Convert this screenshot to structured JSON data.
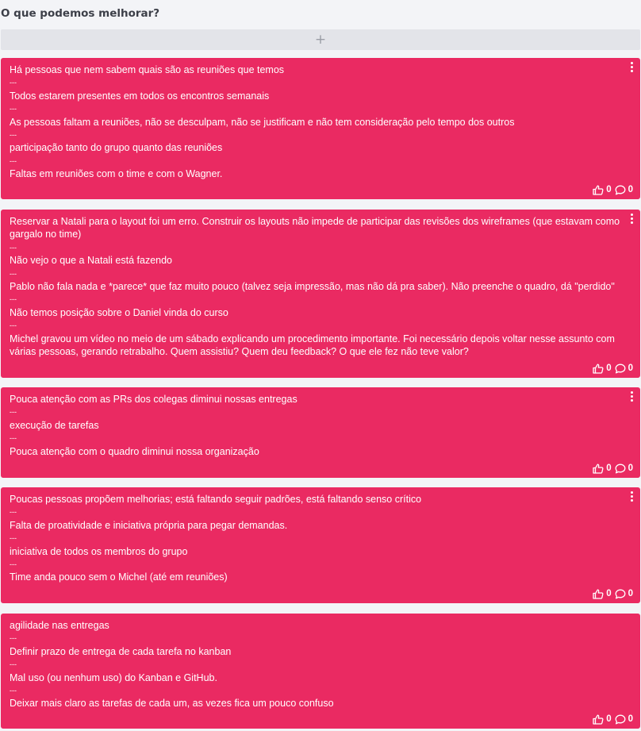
{
  "column": {
    "title": "O que podemos melhorar?",
    "add_symbol": "+"
  },
  "cards": [
    {
      "lines": [
        "Há pessoas que nem sabem quais são as reuniões que temos",
        "---",
        "Todos estarem presentes em todos os encontros semanais",
        "---",
        "As pessoas faltam a reuniões, não se desculpam, não se justificam e não tem consideração pelo tempo dos outros",
        "---",
        "participação tanto do grupo quanto das reuniões",
        "---",
        "Faltas em reuniões com o time e com o Wagner."
      ],
      "likes": "0",
      "comments": "0",
      "has_menu": true
    },
    {
      "lines": [
        "Reservar a Natali para o layout foi um erro. Construir os layouts não impede de participar das revisões dos wireframes (que estavam como gargalo no time)",
        "---",
        "Não vejo o que a Natali está fazendo",
        "---",
        "Pablo não fala nada e *parece* que faz muito pouco (talvez seja impressão, mas não dá pra saber). Não preenche o quadro, dá \"perdido\"",
        "---",
        "Não temos posição sobre o Daniel vinda do curso",
        "---",
        "Michel gravou um vídeo no meio de um sábado explicando um procedimento importante. Foi necessário depois voltar nesse assunto com várias pessoas, gerando retrabalho. Quem assistiu? Quem deu feedback? O que ele fez não teve valor?"
      ],
      "likes": "0",
      "comments": "0",
      "has_menu": true
    },
    {
      "lines": [
        "Pouca atenção com as PRs dos colegas diminui nossas entregas",
        "---",
        "execução de tarefas",
        "---",
        "Pouca atenção com o quadro diminui nossa organização"
      ],
      "likes": "0",
      "comments": "0",
      "has_menu": true
    },
    {
      "lines": [
        "Poucas pessoas propõem melhorias; está faltando seguir padrões, está faltando senso crítico",
        "---",
        "Falta de proatividade e iniciativa própria para pegar demandas.",
        "---",
        "iniciativa de todos os membros do grupo",
        "---",
        "Time anda pouco sem o Michel (até em reuniões)"
      ],
      "likes": "0",
      "comments": "0",
      "has_menu": true
    },
    {
      "lines": [
        "agilidade nas entregas",
        "---",
        "Definir prazo de entrega de cada tarefa no kanban",
        "---",
        "Mal uso (ou nenhum uso) do Kanban e GitHub.",
        "---",
        "Deixar mais claro as tarefas de cada um, as vezes fica um pouco confuso"
      ],
      "likes": "0",
      "comments": "0",
      "has_menu": false
    }
  ],
  "colors": {
    "card": "#ea2a62",
    "background": "#f3f4f7",
    "add_bar": "#e3e4e9"
  },
  "icons": {
    "menu": "kebab-menu-icon",
    "like": "thumbs-up-icon",
    "comment": "comment-bubble-icon"
  }
}
